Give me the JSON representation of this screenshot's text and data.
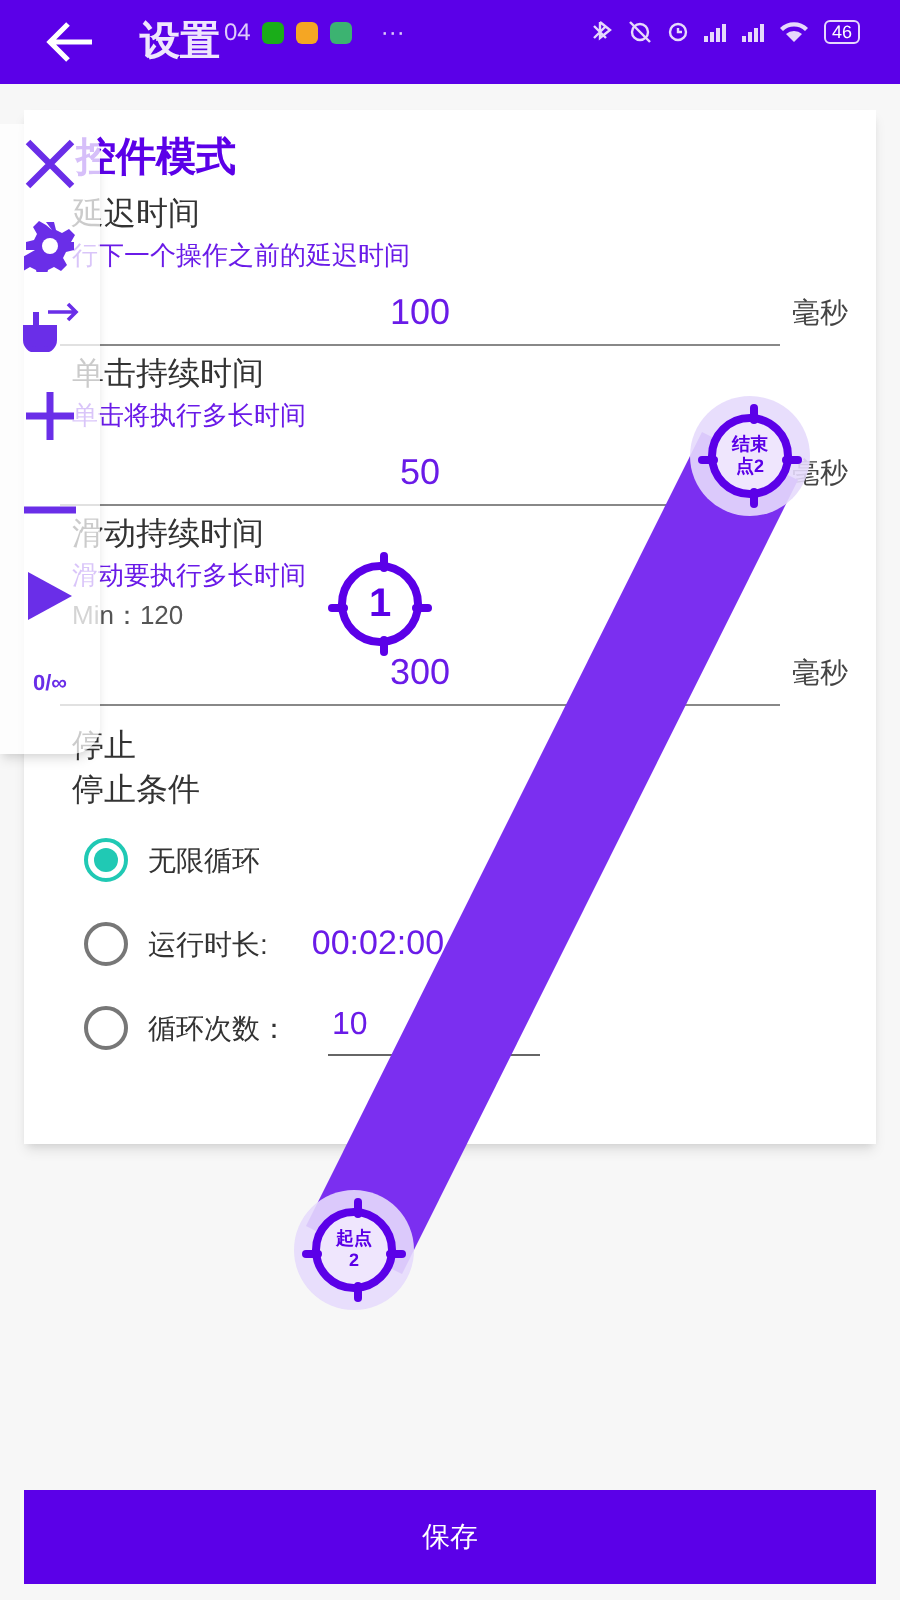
{
  "status_bar": {
    "time": "04",
    "more": "···",
    "battery": "46"
  },
  "app_bar": {
    "title": "设置"
  },
  "section": {
    "title": "控件模式"
  },
  "settings": [
    {
      "label": "延迟时间",
      "hint": "行下一个操作之前的延迟时间",
      "value": "100",
      "unit": "毫秒"
    },
    {
      "label": "单击持续时间",
      "hint": "单击将执行多长时间",
      "value": "50",
      "unit": "毫秒"
    },
    {
      "label": "滑动持续时间",
      "hint": "滑动要执行多长时间",
      "min": "Min：120",
      "value": "300",
      "unit": "毫秒"
    }
  ],
  "stop": {
    "heading": "停止",
    "label": "停止条件",
    "options": [
      {
        "label": "无限循环",
        "selected": true
      },
      {
        "label": "运行时长:",
        "selected": false,
        "kind": "time",
        "value": "00:02:00"
      },
      {
        "label": "循环次数：",
        "selected": false,
        "kind": "field",
        "value": "10"
      }
    ]
  },
  "toolbar": {
    "counter": "0/∞"
  },
  "markers": [
    {
      "kind": "tap",
      "label": "1"
    },
    {
      "kind": "end",
      "label": "结束点2"
    },
    {
      "kind": "start",
      "label": "起点2"
    }
  ],
  "save_button": "保存"
}
